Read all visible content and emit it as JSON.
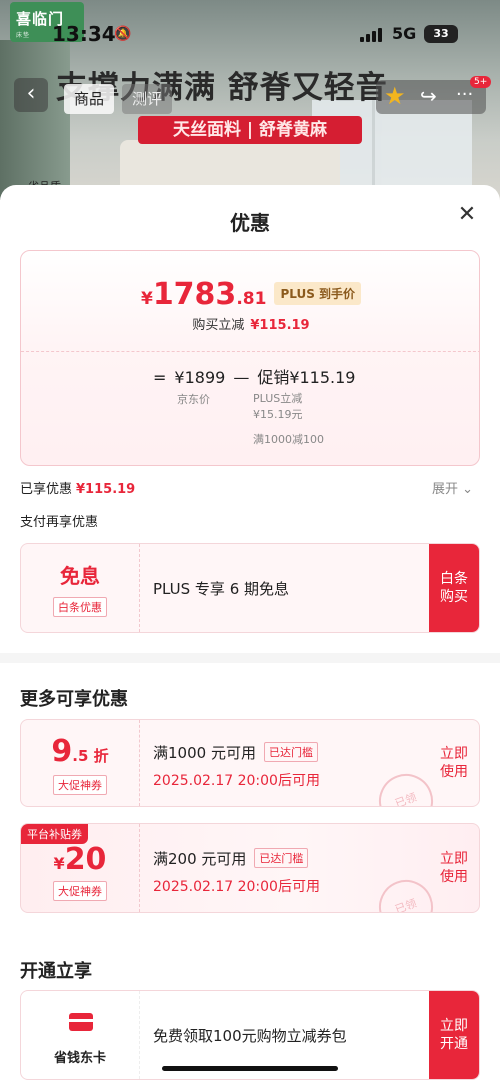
{
  "status": {
    "time": "13:34",
    "network": "5G",
    "battery": "33"
  },
  "background": {
    "logo_text": "喜临门",
    "logo_sub": "床垫",
    "banner": "支撑力满满 舒脊又轻音",
    "tabs": [
      "商品",
      "测评"
    ],
    "red_bar": "天丝面料 | 舒脊黄麻",
    "small_tag": "省品质",
    "more_badge": "5+"
  },
  "sheet": {
    "title": "优惠",
    "price": {
      "symbol": "¥",
      "integer": "1783",
      "decimal": ".81",
      "plus_tag": "PLUS 到手价",
      "reduce_label": "购买立减",
      "reduce_value": "¥115.19",
      "eq": "=",
      "jd_price": "¥1899",
      "minus": "—",
      "promo": "促销¥115.19",
      "jd_price_label": "京东价",
      "plus_cut_line1": "PLUS立减",
      "plus_cut_line2": "¥15.19元",
      "full_cut": "满1000减100"
    },
    "enjoyed_label": "已享优惠",
    "enjoyed_value": "¥115.19",
    "expand": "展开",
    "pay_more": "支付再享优惠",
    "baitiao": {
      "left_main": "免息",
      "left_tag": "白条优惠",
      "desc": "PLUS 专享 6 期免息",
      "button_line1": "白条",
      "button_line2": "购买"
    },
    "more_section_title": "更多可享优惠",
    "coupons": [
      {
        "left_big": "9",
        "left_small": ".5 折",
        "tag": "大促神券",
        "desc": "满1000 元可用",
        "reached": "已达门槛",
        "time": "2025.02.17 20:00后可用",
        "btn_line1": "立即",
        "btn_line2": "使用",
        "stamp": "已领"
      },
      {
        "corner": "平台补贴券",
        "left_sym": "¥",
        "left_big": "20",
        "tag": "大促神券",
        "desc": "满200 元可用",
        "reached": "已达门槛",
        "time": "2025.02.17 20:00后可用",
        "btn_line1": "立即",
        "btn_line2": "使用",
        "stamp": "已领"
      }
    ],
    "open_section_title": "开通立享",
    "saver": {
      "label": "省钱东卡",
      "desc": "免费领取100元购物立减券包",
      "btn_line1": "立即",
      "btn_line2": "开通"
    }
  }
}
